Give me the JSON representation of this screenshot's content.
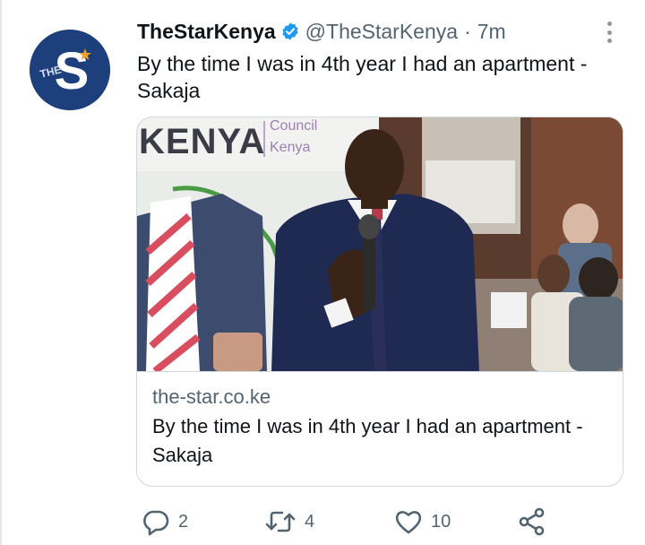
{
  "tweet": {
    "display_name": "TheStarKenya",
    "handle": "@TheStarKenya",
    "separator": "·",
    "timestamp": "7m",
    "text": "By the time I was in 4th year I had an apartment - Sakaja",
    "avatar_icon": "the-star-logo-icon",
    "verified_icon": "verified-badge-icon",
    "more_icon": "more-options-icon"
  },
  "card": {
    "image_icon": "article-photo",
    "domain": "the-star.co.ke",
    "title": "By the time I was in 4th year I had an apartment - Sakaja"
  },
  "actions": {
    "reply": {
      "icon": "reply-icon",
      "count": "2"
    },
    "retweet": {
      "icon": "retweet-icon",
      "count": "4"
    },
    "like": {
      "icon": "heart-icon",
      "count": "10"
    },
    "share": {
      "icon": "share-icon"
    }
  },
  "colors": {
    "text_primary": "#0f1419",
    "text_secondary": "#536471",
    "verified": "#1d9bf0",
    "border": "#cfd9de",
    "avatar_bg": "#1d3f7c"
  }
}
